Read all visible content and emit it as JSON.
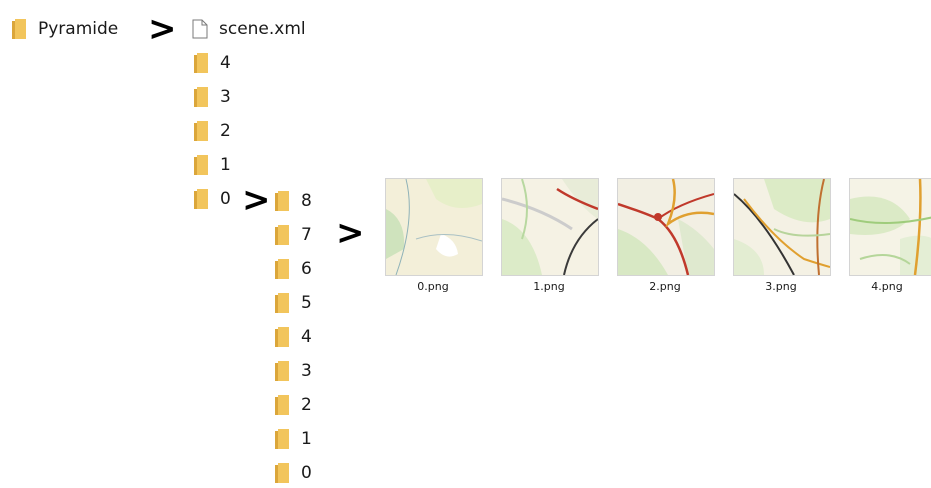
{
  "root": {
    "label": "Pyramide"
  },
  "root_arrow": ">",
  "level1": {
    "file": "scene.xml",
    "folders": [
      "4",
      "3",
      "2",
      "1",
      "0"
    ]
  },
  "level1_arrow": ">",
  "level2": {
    "folders": [
      "8",
      "7",
      "6",
      "5",
      "4",
      "3",
      "2",
      "1",
      "0"
    ]
  },
  "level2_arrow": ">",
  "tiles": [
    {
      "label": "0.png",
      "icon": "map-tile-thumbnail"
    },
    {
      "label": "1.png",
      "icon": "map-tile-thumbnail"
    },
    {
      "label": "2.png",
      "icon": "map-tile-thumbnail"
    },
    {
      "label": "3.png",
      "icon": "map-tile-thumbnail"
    },
    {
      "label": "4.png",
      "icon": "map-tile-thumbnail"
    }
  ],
  "colors": {
    "folder": "#f2c55c",
    "folder_dark": "#dba63a",
    "map_bg": "#f4f1e3",
    "map_green": "#cde3b8",
    "map_road_red": "#c0392b",
    "map_road_orange": "#e0a030"
  }
}
